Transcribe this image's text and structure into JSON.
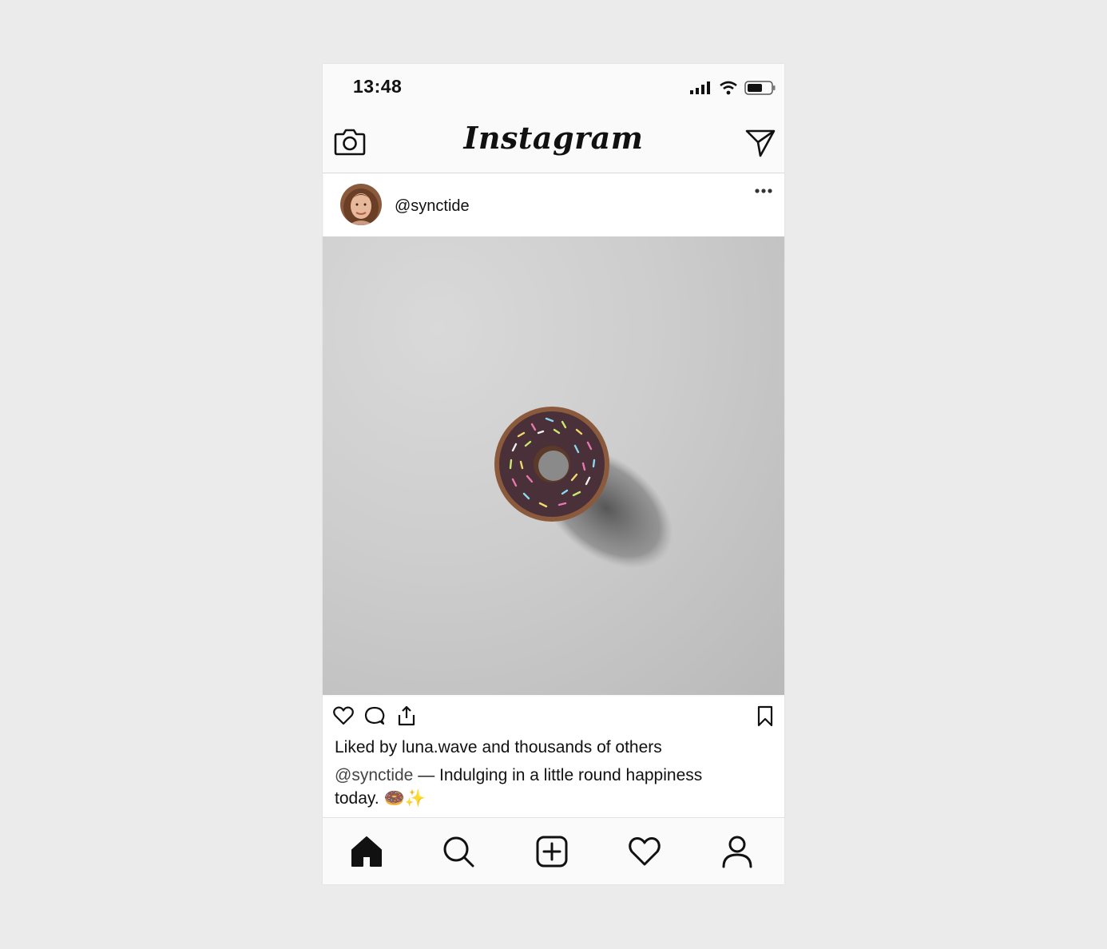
{
  "status": {
    "time": "13:48"
  },
  "app": {
    "title": "Instagram"
  },
  "post": {
    "username": "@synctide",
    "image_subject": "chocolate-sprinkle-donut",
    "likes_text": "Liked by luna.wave and thousands of others",
    "caption_user": "@synctide",
    "caption_text": " — Indulging in a little round happiness today. 🍩✨"
  },
  "icons": {
    "camera": "camera-icon",
    "direct": "paper-plane-icon",
    "more": "more-dots-icon",
    "like": "heart-icon",
    "comment": "comment-icon",
    "share": "share-icon",
    "save": "bookmark-icon",
    "home": "home-icon",
    "search": "search-icon",
    "add": "add-post-icon",
    "activity": "heart-icon",
    "profile": "profile-icon"
  },
  "colors": {
    "background": "#ebebeb",
    "ink": "#111111",
    "donut_glaze": "#4a3038"
  }
}
